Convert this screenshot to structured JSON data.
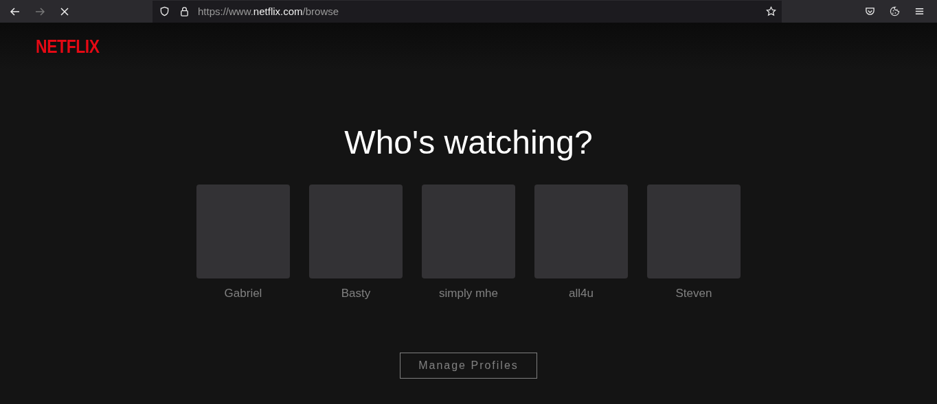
{
  "browser": {
    "url_scheme": "https://www.",
    "url_domain": "netflix.com",
    "url_path": "/browse",
    "loading": true
  },
  "logo": "NETFLIX",
  "heading": "Who's watching?",
  "profiles": [
    {
      "name": "Gabriel"
    },
    {
      "name": "Basty"
    },
    {
      "name": "simply mhe"
    },
    {
      "name": "all4u"
    },
    {
      "name": "Steven"
    }
  ],
  "manage_button": "Manage Profiles"
}
